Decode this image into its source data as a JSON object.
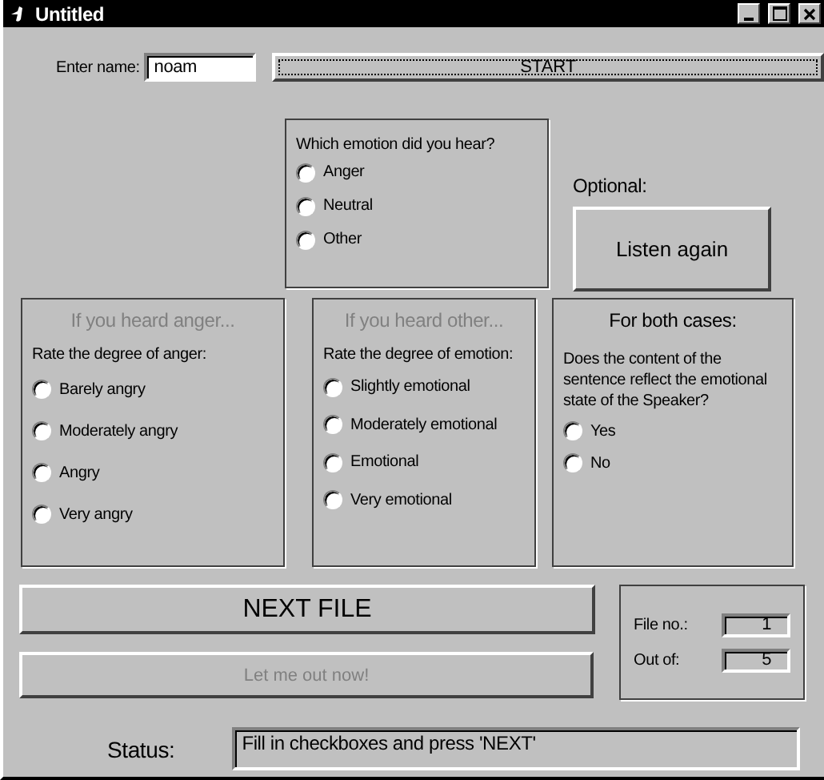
{
  "window": {
    "title": "Untitled"
  },
  "name_field": {
    "label": "Enter name:",
    "value": "noam"
  },
  "start_button": {
    "label": "START",
    "focused": true
  },
  "emotion_group": {
    "question": "Which emotion did you hear?",
    "options": [
      {
        "label": "Anger",
        "selected": false
      },
      {
        "label": "Neutral",
        "selected": false
      },
      {
        "label": "Other",
        "selected": false
      }
    ]
  },
  "optional": {
    "label": "Optional:",
    "button": "Listen again"
  },
  "panels": [
    {
      "title": "If you heard anger...",
      "disabled": true,
      "question": "Rate the degree of anger:",
      "options": [
        {
          "label": "Barely angry",
          "selected": false
        },
        {
          "label": "Moderately angry",
          "selected": false
        },
        {
          "label": "Angry",
          "selected": false
        },
        {
          "label": "Very angry",
          "selected": false
        }
      ]
    },
    {
      "title": "If you heard other...",
      "disabled": true,
      "question": "Rate the degree of emotion:",
      "options": [
        {
          "label": "Slightly emotional",
          "selected": false
        },
        {
          "label": "Moderately emotional",
          "selected": false
        },
        {
          "label": "Emotional",
          "selected": false
        },
        {
          "label": "Very emotional",
          "selected": false
        }
      ]
    },
    {
      "title": "For both cases:",
      "disabled": false,
      "question": "Does the content of the sentence reflect the emotional state of the Speaker?",
      "options": [
        {
          "label": "Yes",
          "selected": false
        },
        {
          "label": "No",
          "selected": false
        }
      ]
    }
  ],
  "next_button": {
    "label": "NEXT FILE",
    "disabled": false
  },
  "exit_button": {
    "label": "Let me out now!",
    "disabled": true
  },
  "file_counter": [
    {
      "label": "File no.:",
      "value": "1"
    },
    {
      "label": "Out of:",
      "value": "5"
    }
  ],
  "status": {
    "label": "Status:",
    "value": "Fill in checkboxes and press 'NEXT'"
  }
}
